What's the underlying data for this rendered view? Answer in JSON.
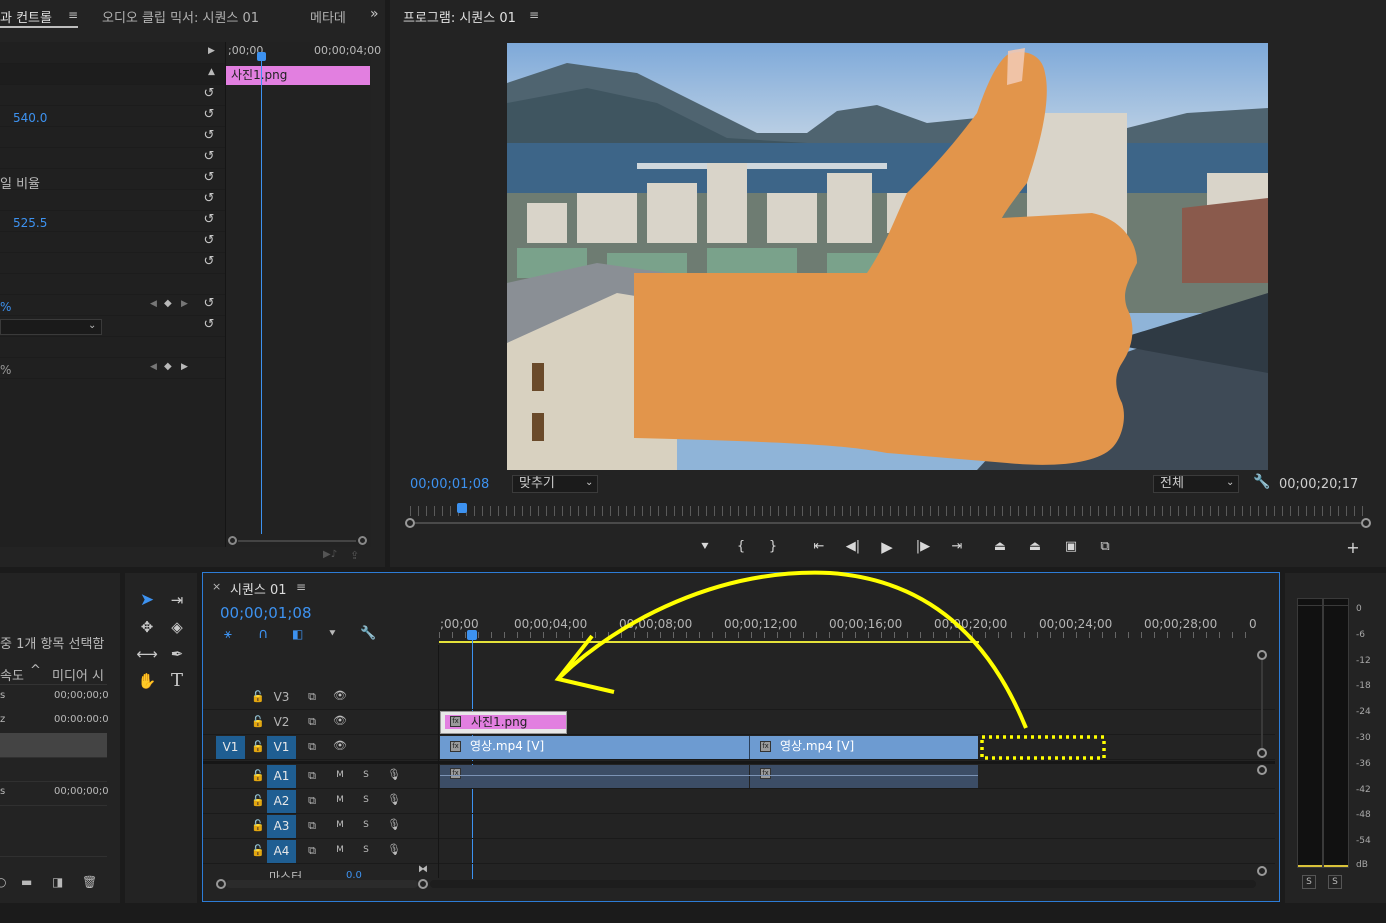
{
  "effect_controls": {
    "tab_label": "효과 컨트롤",
    "tab_label_visible": "과 컨트롤",
    "mixer_tab": "오디오 클립 믹서: 시퀀스 01",
    "meta_tab": "메타데",
    "ruler_start": ";00;00",
    "ruler_end": "00;00;04;00",
    "clip_name": "사진1.png",
    "pos_y_value": "540.0",
    "uniform_scale_label": "일 비율",
    "anchor_y_value": "525.5",
    "pct_label_1": "%",
    "pct_label_2": "%"
  },
  "program": {
    "title": "프로그램: 시퀀스 01",
    "timecode_current": "00;00;01;08",
    "zoom_select": "맞추기",
    "quality_select": "전체",
    "timecode_duration": "00;00;20;17"
  },
  "project": {
    "status": "중 1개 항목 선택함",
    "col_speed": "속도",
    "col_media": "미디어 시",
    "rows": [
      {
        "left": "s",
        "value": "00;00;00;0"
      },
      {
        "left": "z",
        "value": "00:00:00:0"
      },
      {
        "left": "",
        "value": ""
      },
      {
        "left": "s",
        "value": "00;00;00;0"
      }
    ]
  },
  "timeline": {
    "tab_label": "시퀀스 01",
    "timecode": "00;00;01;08",
    "ticks": [
      ";00;00",
      "00;00;04;00",
      "00;00;08;00",
      "00;00;12;00",
      "00;00;16;00",
      "00;00;20;00",
      "00;00;24;00",
      "00;00;28;00",
      "0"
    ],
    "tracks": {
      "video": [
        "V3",
        "V2",
        "V1"
      ],
      "audio": [
        "A1",
        "A2",
        "A3",
        "A4"
      ],
      "source_v1": "V1",
      "master_label": "마스터",
      "master_value": "0.0"
    },
    "clips": {
      "image": "사진1.png",
      "video_a": "영상.mp4 [V]",
      "video_b": "영상.mp4 [V]"
    },
    "mute": "M",
    "solo": "S"
  },
  "meter": {
    "scale": [
      "0",
      "-6",
      "-12",
      "-18",
      "-24",
      "-30",
      "-36",
      "-42",
      "-48",
      "-54",
      "dB"
    ],
    "solo_left": "S",
    "solo_right": "S"
  },
  "colors": {
    "accent_blue": "#3d92f0",
    "clip_pink": "#e27fe0",
    "clip_video": "#6d9bd1",
    "annotation_yellow": "#ffff00",
    "thumb_orange": "#e2954b"
  }
}
